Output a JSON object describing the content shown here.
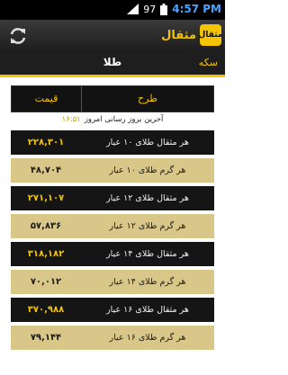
{
  "status": {
    "battery_level": "97",
    "time": "4:57 PM"
  },
  "app": {
    "logo_text": "مثقال",
    "title": "مثقال"
  },
  "tabs": {
    "gold": "طلا",
    "coin": "سکه"
  },
  "table": {
    "header": {
      "item": "طرح",
      "price": "قیمت"
    },
    "update_label": "آخرین بروز رسانی امروز",
    "update_time": "۱۶:۵۱",
    "rows": [
      {
        "label": "هر مثقال طلای ۱۰ عیار",
        "price": "۲۲۸,۳۰۱",
        "style": "dark"
      },
      {
        "label": "هر گرم طلای ۱۰ عیار",
        "price": "۴۸,۷۰۴",
        "style": "light"
      },
      {
        "label": "هر مثقال طلای ۱۲ عیار",
        "price": "۲۷۱,۱۰۷",
        "style": "dark"
      },
      {
        "label": "هر گرم طلای ۱۲ عیار",
        "price": "۵۷,۸۳۶",
        "style": "light"
      },
      {
        "label": "هر مثقال طلای ۱۴ عیار",
        "price": "۳۱۸,۱۸۲",
        "style": "dark"
      },
      {
        "label": "هر گرم طلای ۱۴ عیار",
        "price": "۷۰,۰۱۲",
        "style": "light"
      },
      {
        "label": "هر مثقال طلای ۱۶ عیار",
        "price": "۳۷۰,۹۸۸",
        "style": "dark"
      },
      {
        "label": "هر گرم طلای ۱۶ عیار",
        "price": "۷۹,۱۴۴",
        "style": "light"
      }
    ]
  }
}
